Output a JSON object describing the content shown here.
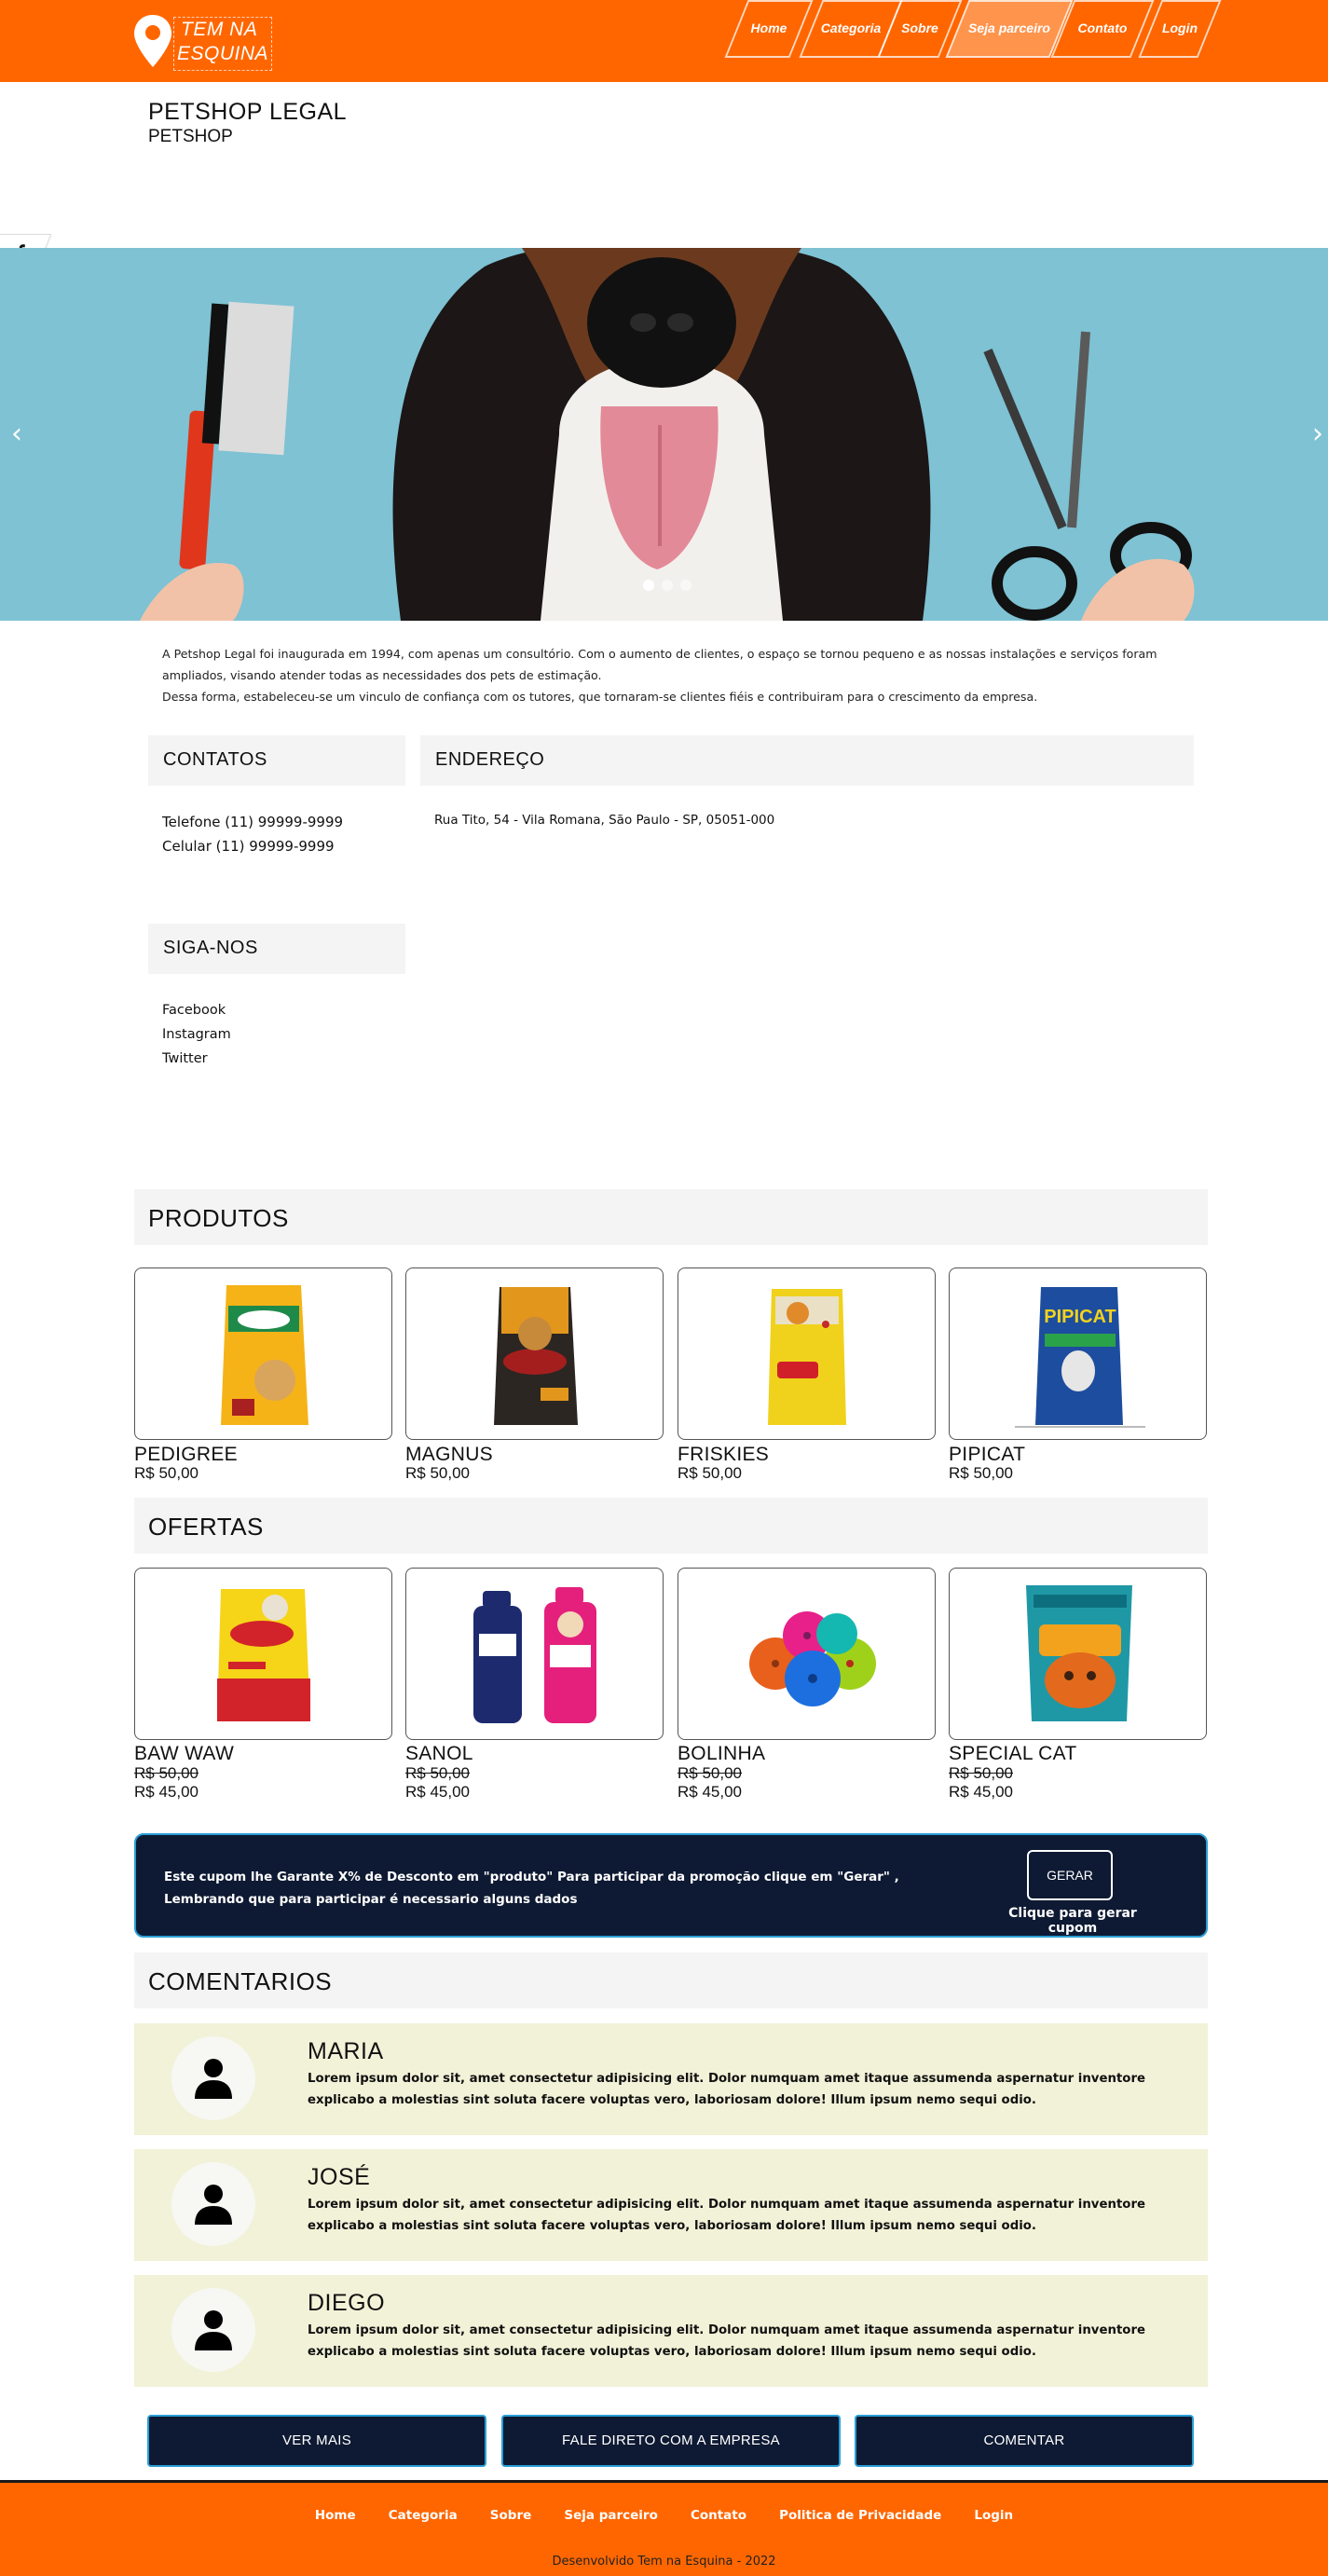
{
  "header": {
    "logo_line1": "TEM NA",
    "logo_line2": "ESQUINA",
    "nav": [
      "Home",
      "Categoria",
      "Sobre",
      "Seja parceiro",
      "Contato",
      "Login"
    ],
    "active_nav": "Seja parceiro",
    "brand_color": "#ff6600"
  },
  "store": {
    "name": "PETSHOP LEGAL",
    "category": "PETSHOP"
  },
  "social_side": [
    "facebook-icon",
    "instagram-icon",
    "twitter-icon"
  ],
  "carousel": {
    "prev": "‹",
    "next": "›",
    "slide_count": 3,
    "active_slide": 1
  },
  "about": {
    "p1": "A Petshop Legal foi inaugurada em 1994, com apenas um consultório. Com o aumento de clientes, o espaço se tornou pequeno e as nossas instalações e serviços foram ampliados, visando atender todas as necessidades dos pets de estimação.",
    "p2": "Dessa forma, estabeleceu-se um vinculo de confiança com os tutores, que tornaram-se clientes fiéis e contribuiram para o crescimento da empresa."
  },
  "contacts": {
    "title": "CONTATOS",
    "phone": "Telefone (11) 99999-9999",
    "cell": "Celular (11) 99999-9999"
  },
  "address": {
    "title": "ENDEREÇO",
    "text": "Rua Tito, 54 - Vila Romana, São Paulo - SP, 05051-000"
  },
  "follow": {
    "title": "SIGA-NOS",
    "links": [
      "Facebook",
      "Instagram",
      "Twitter"
    ]
  },
  "products": {
    "title": "PRODUTOS",
    "items": [
      {
        "name": "PEDIGREE",
        "price": "R$ 50,00"
      },
      {
        "name": "MAGNUS",
        "price": "R$ 50,00"
      },
      {
        "name": "FRISKIES",
        "price": "R$ 50,00"
      },
      {
        "name": "PIPICAT",
        "price": "R$ 50,00"
      }
    ]
  },
  "offers": {
    "title": "OFERTAS",
    "items": [
      {
        "name": "BAW WAW",
        "old_price": "R$ 50,00",
        "price": "R$ 45,00"
      },
      {
        "name": "SANOL",
        "old_price": "R$ 50,00",
        "price": "R$ 45,00"
      },
      {
        "name": "BOLINHA",
        "old_price": "R$ 50,00",
        "price": "R$ 45,00"
      },
      {
        "name": "SPECIAL CAT",
        "old_price": "R$ 50,00",
        "price": "R$ 45,00"
      }
    ]
  },
  "coupon": {
    "text": "Este cupom lhe Garante X% de Desconto em \"produto\" Para participar da promoção clique em \"Gerar\" , Lembrando que para participar é necessario alguns dados",
    "button": "GERAR",
    "hint": "Clique para gerar cupom"
  },
  "comments": {
    "title": "COMENTARIOS",
    "items": [
      {
        "name": "MARIA",
        "text": "Lorem ipsum dolor sit, amet consectetur adipisicing elit. Dolor numquam amet itaque assumenda aspernatur inventore explicabo a molestias sint soluta facere voluptas vero, laboriosam dolore! Illum ipsum nemo sequi odio."
      },
      {
        "name": "JOSÉ",
        "text": "Lorem ipsum dolor sit, amet consectetur adipisicing elit. Dolor numquam amet itaque assumenda aspernatur inventore explicabo a molestias sint soluta facere voluptas vero, laboriosam dolore! Illum ipsum nemo sequi odio."
      },
      {
        "name": "DIEGO",
        "text": "Lorem ipsum dolor sit, amet consectetur adipisicing elit. Dolor numquam amet itaque assumenda aspernatur inventore explicabo a molestias sint soluta facere voluptas vero, laboriosam dolore! Illum ipsum nemo sequi odio."
      }
    ]
  },
  "actions": {
    "more": "VER MAIS",
    "contact": "FALE DIRETO COM A EMPRESA",
    "comment": "COMENTAR"
  },
  "footer": {
    "links": [
      "Home",
      "Categoria",
      "Sobre",
      "Seja parceiro",
      "Contato",
      "Politica de Privacidade",
      "Login"
    ],
    "copyright": "Desenvolvido Tem na Esquina - 2022"
  }
}
